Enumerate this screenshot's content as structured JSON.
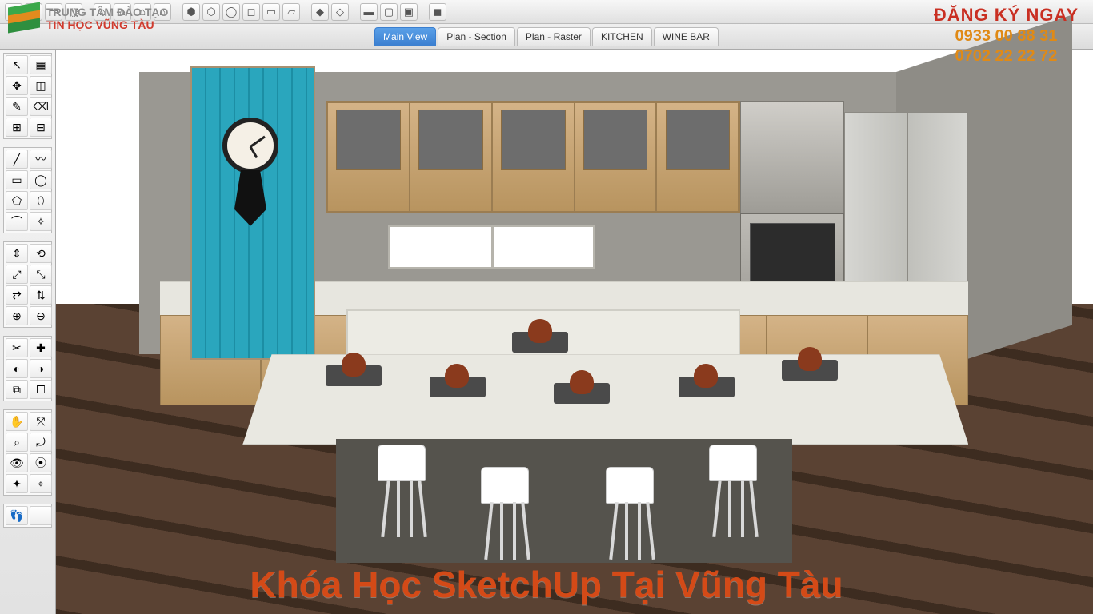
{
  "top_toolbar": {
    "buttons": [
      "◧",
      "◫",
      "▭",
      "⬚",
      "⌂",
      "⌂",
      "⌂",
      "⌂",
      "⬢",
      "⬡",
      "◯",
      "◻",
      "▭",
      "▱",
      "◆",
      "◇",
      "▬",
      "▢",
      "▣",
      "◼"
    ]
  },
  "scenes": {
    "tabs": [
      {
        "label": "Main View",
        "active": true
      },
      {
        "label": "Plan - Section",
        "active": false
      },
      {
        "label": "Plan - Raster",
        "active": false
      },
      {
        "label": "KITCHEN",
        "active": false
      },
      {
        "label": "WINE BAR",
        "active": false
      }
    ]
  },
  "tool_palettes": [
    {
      "name": "principal",
      "tools": [
        "↖",
        "▦",
        "✥",
        "◫",
        "✎",
        "⌫",
        "⊞",
        "⊟"
      ]
    },
    {
      "name": "draw",
      "tools": [
        "╱",
        "〰",
        "▭",
        "◯",
        "⬠",
        "⬯",
        "⌒",
        "✧"
      ]
    },
    {
      "name": "modify",
      "tools": [
        "⇕",
        "⟲",
        "⤢",
        "⤡",
        "⇄",
        "⇅",
        "⊕",
        "⊖"
      ]
    },
    {
      "name": "construct",
      "tools": [
        "✂",
        "✚",
        "◐",
        "◑",
        "⧉",
        "⧠"
      ]
    },
    {
      "name": "camera",
      "tools": [
        "✋",
        "⤧",
        "⌕",
        "⤾",
        "👁",
        "⦿",
        "✦",
        "⌖"
      ]
    },
    {
      "name": "walk",
      "tools": [
        "👣",
        ""
      ]
    }
  ],
  "overlays": {
    "logo_line1": "TRUNG TÂM ĐÀO TẠO",
    "logo_line2": "TIN HỌC VŨNG TÀU",
    "cta_curve": "ĐĂNG KÝ NGAY",
    "phone1": "0933 00 88 31",
    "phone2": "0702 22 22 72",
    "course_title": "Khóa Học SketchUp Tại Vũng Tàu"
  }
}
